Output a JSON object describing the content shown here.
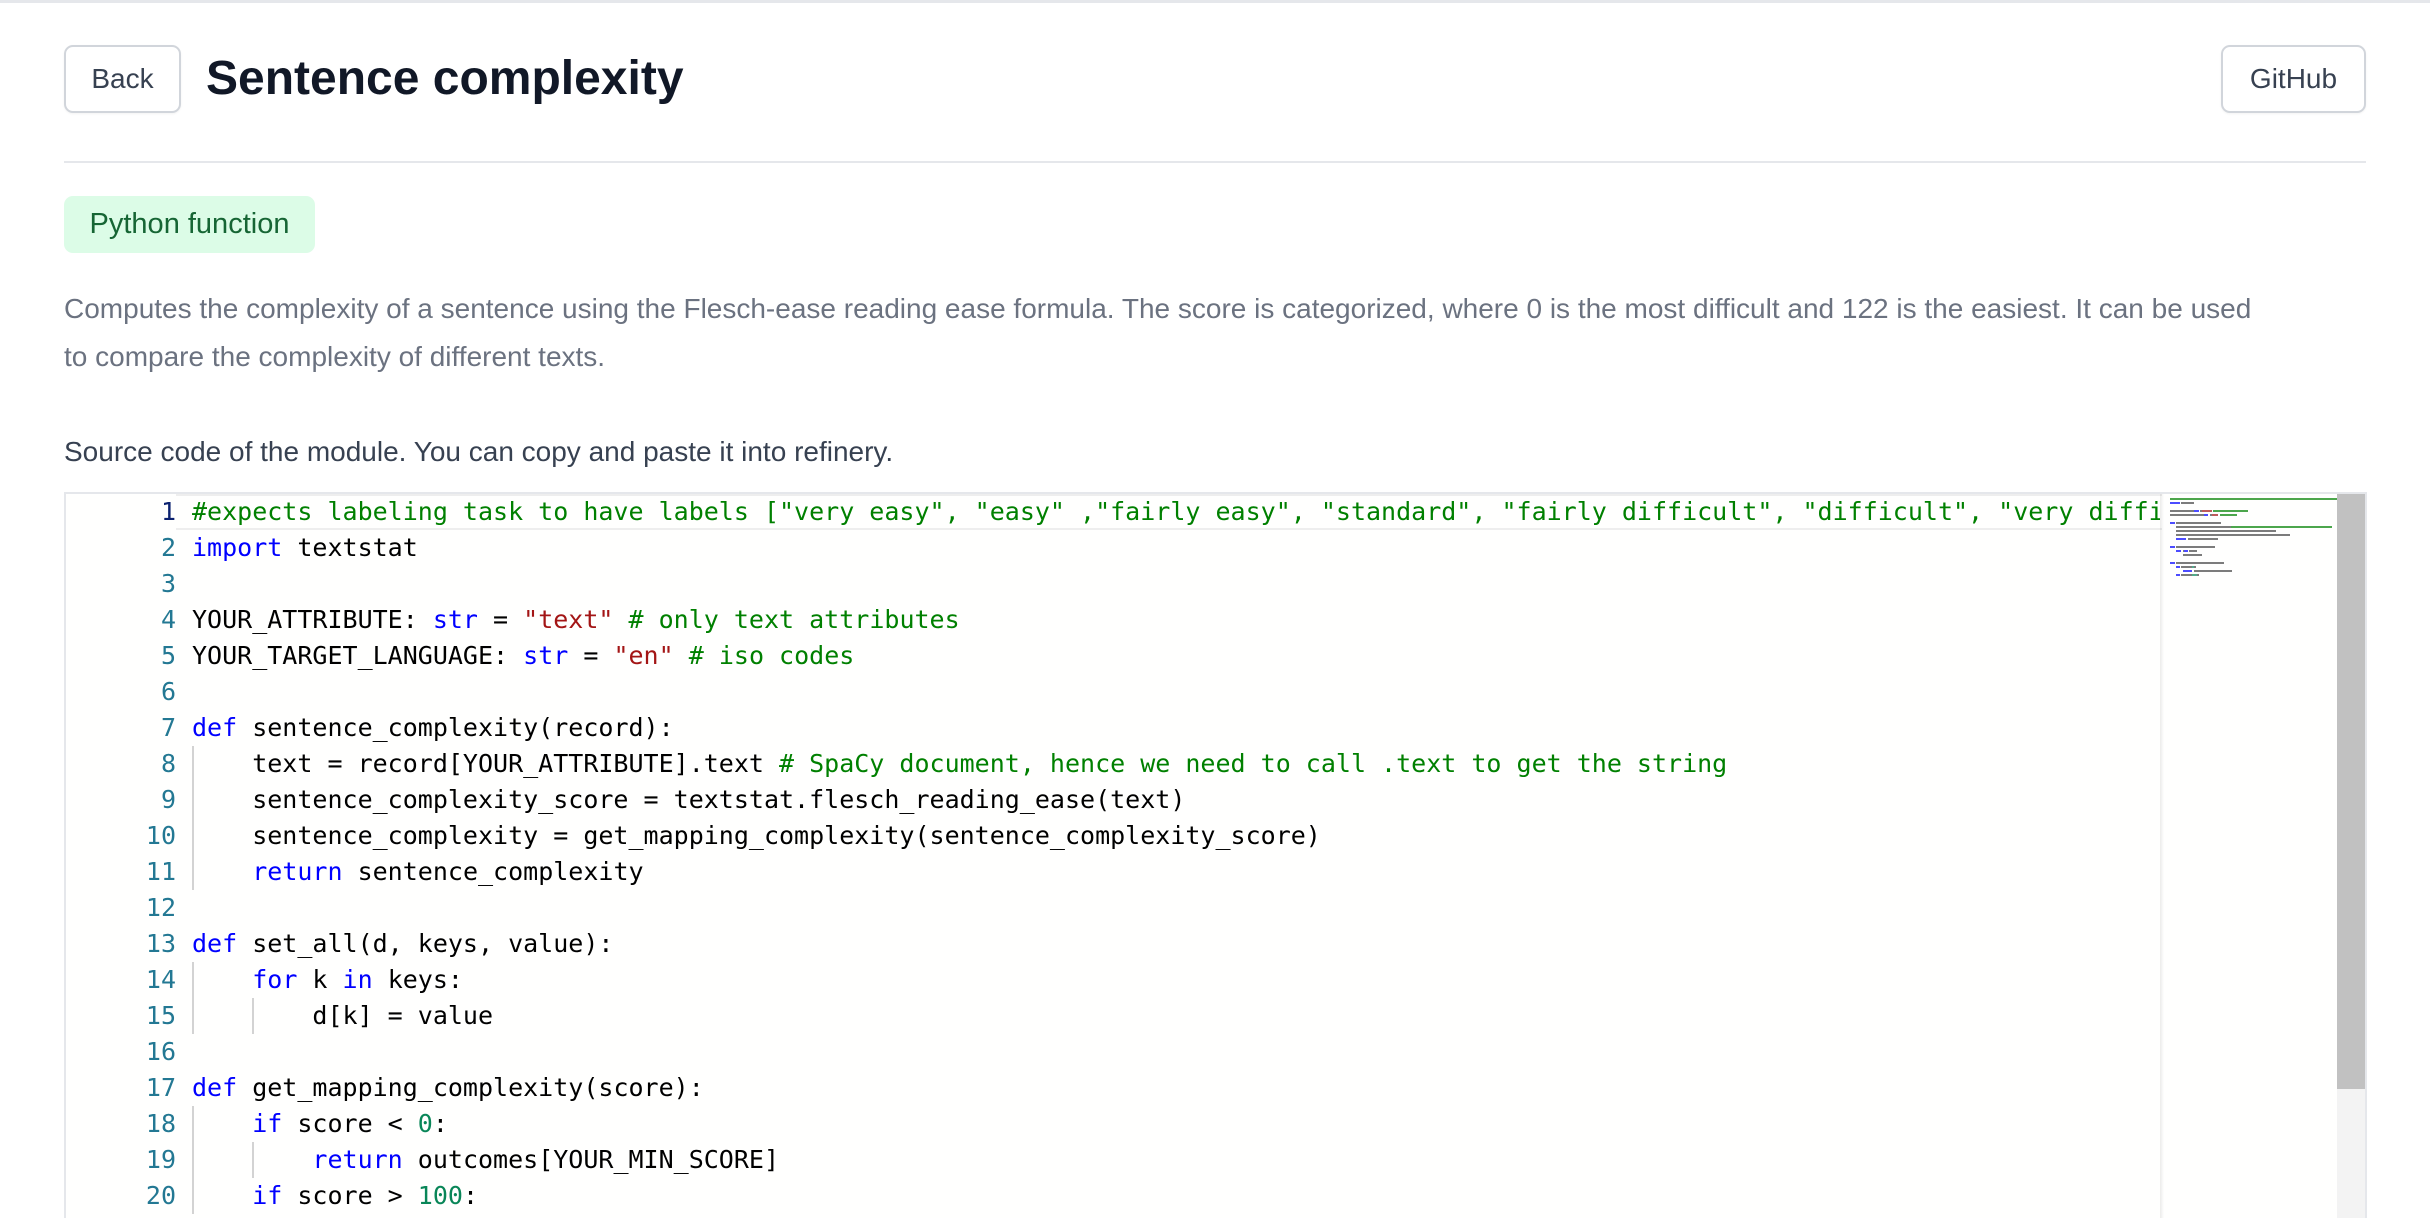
{
  "header": {
    "back_label": "Back",
    "title": "Sentence complexity",
    "github_label": "GitHub"
  },
  "badge": "Python function",
  "description_line1": "Computes the complexity of a sentence using the Flesch-ease reading ease formula. The score is categorized, where 0 is the most difficult and 122 is the easiest. It can be used",
  "description_line2": "to compare the complexity of different texts.",
  "source_label": "Source code of the module. You can copy and paste it into refinery.",
  "editor": {
    "current_line": 1,
    "colors": {
      "keyword": "#0000ff",
      "string": "#a31515",
      "comment": "#008000",
      "number": "#098658",
      "line_number": "#237893"
    },
    "lines": [
      {
        "n": "1",
        "tokens": [
          [
            "cm",
            "#expects labeling task to have labels [\"very easy\", \"easy\" ,\"fairly easy\", \"standard\", \"fairly difficult\", \"difficult\", \"very diffic"
          ]
        ]
      },
      {
        "n": "2",
        "tokens": [
          [
            "kw",
            "import"
          ],
          [
            "",
            " textstat"
          ]
        ]
      },
      {
        "n": "3",
        "tokens": []
      },
      {
        "n": "4",
        "tokens": [
          [
            "",
            "YOUR_ATTRIBUTE: "
          ],
          [
            "kw",
            "str"
          ],
          [
            "",
            " = "
          ],
          [
            "str",
            "\"text\""
          ],
          [
            "",
            " "
          ],
          [
            "cm",
            "# only text attributes"
          ]
        ]
      },
      {
        "n": "5",
        "tokens": [
          [
            "",
            "YOUR_TARGET_LANGUAGE: "
          ],
          [
            "kw",
            "str"
          ],
          [
            "",
            " = "
          ],
          [
            "str",
            "\"en\""
          ],
          [
            "",
            " "
          ],
          [
            "cm",
            "# iso codes"
          ]
        ]
      },
      {
        "n": "6",
        "tokens": []
      },
      {
        "n": "7",
        "tokens": [
          [
            "kw",
            "def"
          ],
          [
            "",
            " sentence_complexity(record):"
          ]
        ]
      },
      {
        "n": "8",
        "tokens": [
          [
            "",
            "    text = record[YOUR_ATTRIBUTE].text "
          ],
          [
            "cm",
            "# SpaCy document, hence we need to call .text to get the string"
          ]
        ]
      },
      {
        "n": "9",
        "tokens": [
          [
            "",
            "    sentence_complexity_score = textstat.flesch_reading_ease(text)"
          ]
        ]
      },
      {
        "n": "10",
        "tokens": [
          [
            "",
            "    sentence_complexity = get_mapping_complexity(sentence_complexity_score)"
          ]
        ]
      },
      {
        "n": "11",
        "tokens": [
          [
            "",
            "    "
          ],
          [
            "kw",
            "return"
          ],
          [
            "",
            " sentence_complexity"
          ]
        ]
      },
      {
        "n": "12",
        "tokens": []
      },
      {
        "n": "13",
        "tokens": [
          [
            "kw",
            "def"
          ],
          [
            "",
            " set_all(d, keys, value):"
          ]
        ]
      },
      {
        "n": "14",
        "tokens": [
          [
            "",
            "    "
          ],
          [
            "kw",
            "for"
          ],
          [
            "",
            " k "
          ],
          [
            "kw",
            "in"
          ],
          [
            "",
            " keys:"
          ]
        ]
      },
      {
        "n": "15",
        "tokens": [
          [
            "",
            "        d[k] = value"
          ]
        ]
      },
      {
        "n": "16",
        "tokens": []
      },
      {
        "n": "17",
        "tokens": [
          [
            "kw",
            "def"
          ],
          [
            "",
            " get_mapping_complexity(score):"
          ]
        ]
      },
      {
        "n": "18",
        "tokens": [
          [
            "",
            "    "
          ],
          [
            "kw",
            "if"
          ],
          [
            "",
            " score < "
          ],
          [
            "num",
            "0"
          ],
          [
            "",
            ":"
          ]
        ]
      },
      {
        "n": "19",
        "tokens": [
          [
            "",
            "        "
          ],
          [
            "kw",
            "return"
          ],
          [
            "",
            " outcomes[YOUR_MIN_SCORE]"
          ]
        ]
      },
      {
        "n": "20",
        "tokens": [
          [
            "",
            "    "
          ],
          [
            "kw",
            "if"
          ],
          [
            "",
            " score > "
          ],
          [
            "num",
            "100"
          ],
          [
            "",
            ":"
          ]
        ]
      }
    ]
  }
}
